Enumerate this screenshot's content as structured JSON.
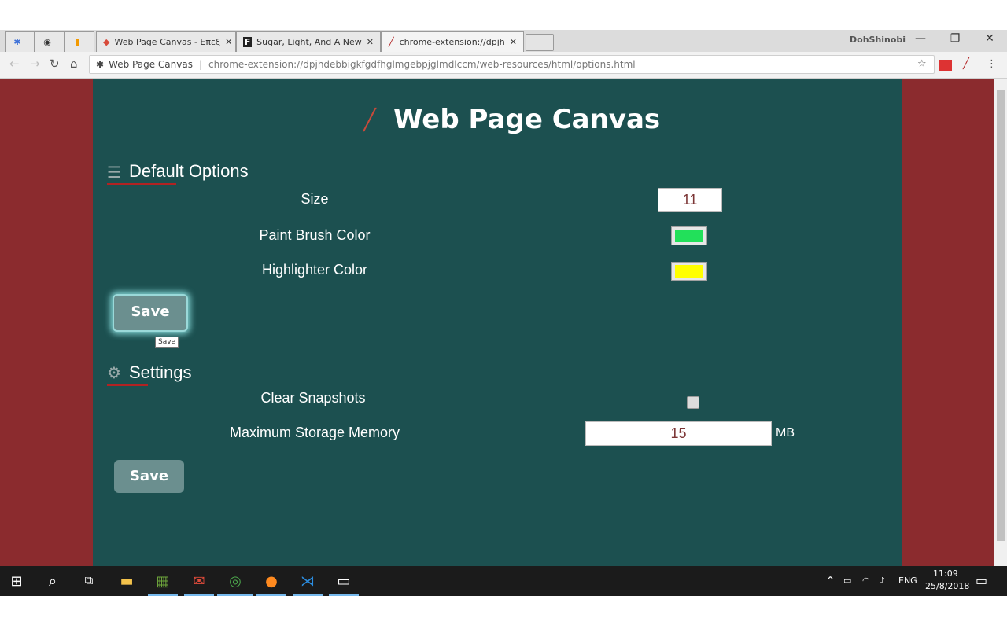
{
  "browser": {
    "tabs": [
      {
        "icon": "puzzle-icon",
        "label": "",
        "close": ""
      },
      {
        "icon": "github-icon",
        "label": "",
        "close": ""
      },
      {
        "icon": "analytics-icon",
        "label": "",
        "close": ""
      },
      {
        "icon": "paint-icon",
        "label": "Web Page Canvas - Επεξ",
        "close": "✕"
      },
      {
        "icon": "f-icon",
        "label": "Sugar, Light, And A New",
        "close": "✕"
      },
      {
        "icon": "brush-icon",
        "label": "chrome-extension://dpjh",
        "close": "✕"
      }
    ],
    "profile": "DohShinobi",
    "window_controls": {
      "minimize": "—",
      "restore": "❐",
      "close": "✕"
    },
    "omnibox": {
      "site": "Web Page Canvas",
      "url": "chrome-extension://dpjhdebbigkfgdfhglmgebpjglmdlccm/web-resources/html/options.html"
    }
  },
  "page": {
    "title": "Web Page Canvas",
    "default_options": {
      "heading": "Default Options",
      "size_label": "Size",
      "size_value": "11",
      "paint_color_label": "Paint Brush Color",
      "paint_color": "#22e05a",
      "highlighter_label": "Highlighter Color",
      "highlighter_color": "#ffff00",
      "save_label": "Save",
      "tooltip": "Save"
    },
    "settings": {
      "heading": "Settings",
      "clear_label": "Clear Snapshots",
      "storage_label": "Maximum Storage Memory",
      "storage_value": "15",
      "storage_unit": "MB",
      "save_label": "Save"
    }
  },
  "colors": {
    "background": "#8b2b2e",
    "panel": "#1c5050",
    "button": "#6b8f8f",
    "accent_underline": "#b22222"
  },
  "taskbar": {
    "language": "ENG",
    "time": "11:09",
    "date": "25/8/2018"
  }
}
